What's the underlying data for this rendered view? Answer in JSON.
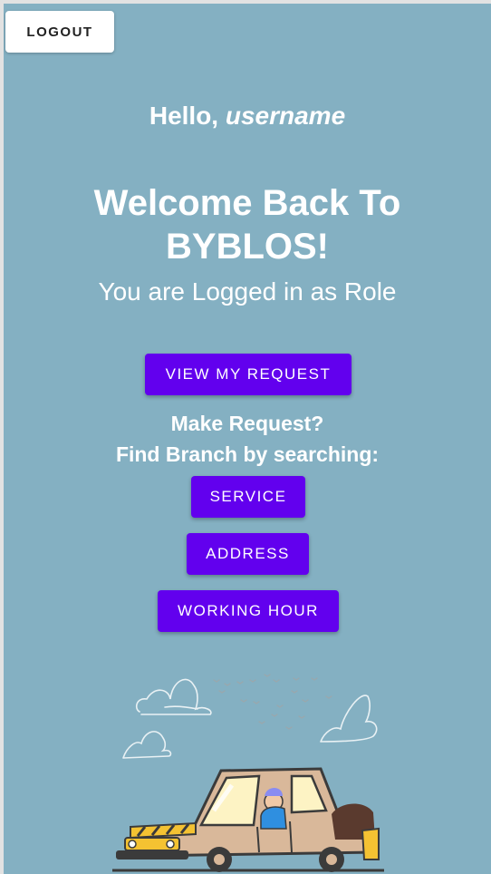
{
  "header": {
    "logout_label": "LOGOUT"
  },
  "greeting": {
    "prefix": "Hello, ",
    "username": "username"
  },
  "welcome": {
    "line1": "Welcome Back To",
    "line2": "BYBLOS!"
  },
  "role_text": "You are Logged in as Role",
  "actions": {
    "view_request_label": "VIEW MY REQUEST",
    "make_request_text": "Make Request?",
    "find_branch_text": "Find Branch by searching:",
    "service_label": "SERVICE",
    "address_label": "ADDRESS",
    "working_hour_label": "WORKING HOUR"
  },
  "colors": {
    "background": "#84b0c2",
    "primary_button": "#6200ee",
    "text": "#ffffff"
  },
  "illustration": {
    "icon": "car-driver-illustration"
  }
}
